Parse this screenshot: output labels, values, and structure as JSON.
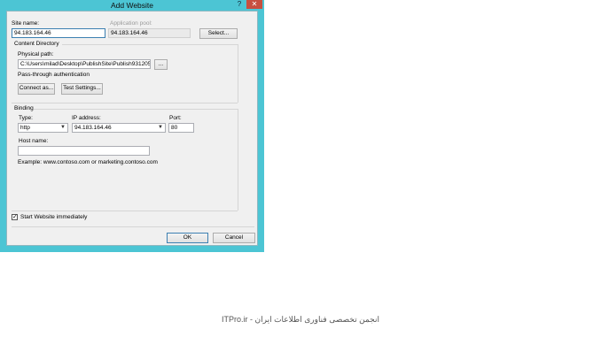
{
  "dialog": {
    "title": "Add Website",
    "help_glyph": "?",
    "close_glyph": "✕"
  },
  "site": {
    "site_name_label": "Site name:",
    "site_name_value": "94.183.164.46",
    "app_pool_label": "Application pool:",
    "app_pool_value": "94.183.164.46",
    "select_button": "Select..."
  },
  "content_directory": {
    "group_label": "Content Directory",
    "physical_path_label": "Physical path:",
    "physical_path_value": "C:\\Users\\milad\\Desktop\\PublishSite\\Publish931205",
    "browse_button": "...",
    "pass_through_label": "Pass-through authentication",
    "connect_as_button": "Connect as...",
    "test_settings_button": "Test Settings..."
  },
  "binding": {
    "group_label": "Binding",
    "type_label": "Type:",
    "type_value": "http",
    "ip_label": "IP address:",
    "ip_value": "94.183.164.46",
    "port_label": "Port:",
    "port_value": "80",
    "host_name_label": "Host name:",
    "host_name_value": "",
    "example_text": "Example: www.contoso.com or marketing.contoso.com"
  },
  "start_website": {
    "label": "Start Website immediately",
    "checked": true,
    "check_glyph": "✓"
  },
  "footer": {
    "ok_button": "OK",
    "cancel_button": "Cancel"
  },
  "watermark": "ITPro.ir - انجمن تخصصی فناوری اطلاعات ایران"
}
